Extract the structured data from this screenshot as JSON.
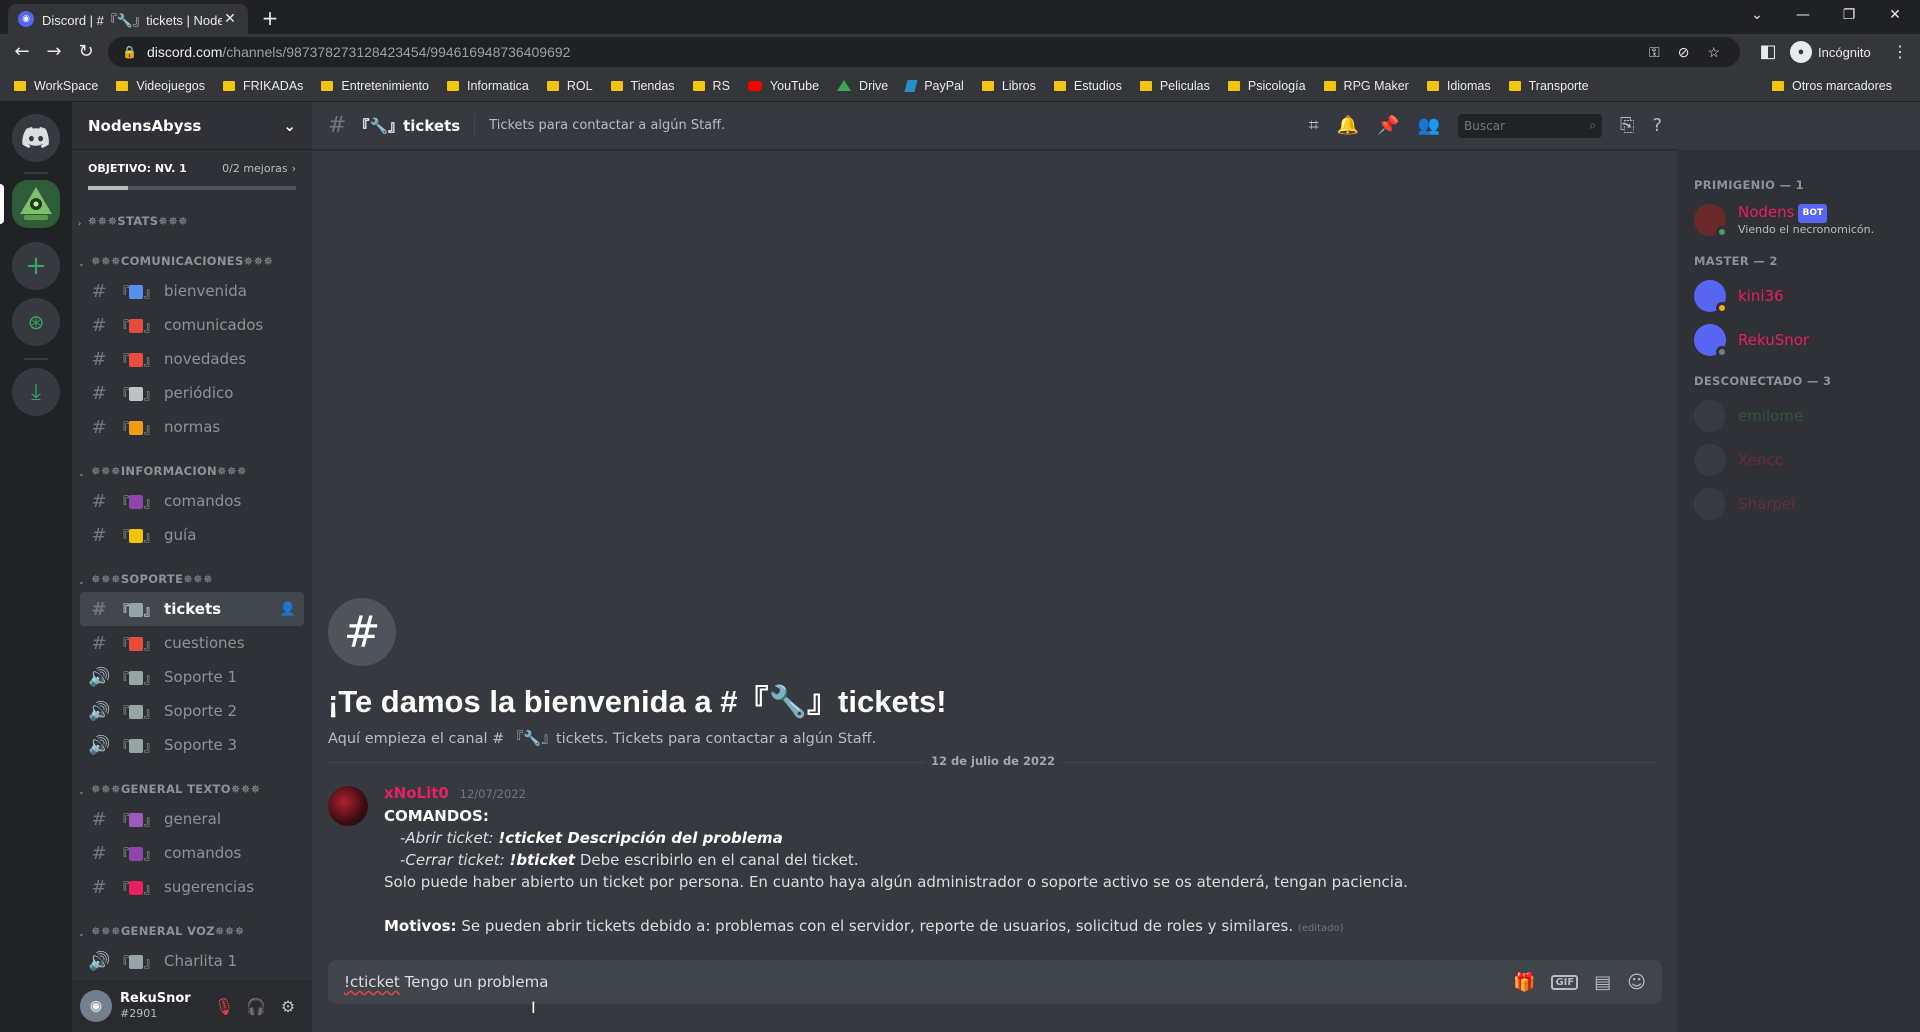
{
  "browser": {
    "tab_title": "Discord | #『🔧』tickets | NodensAbyss",
    "tab_close": "✕",
    "new_tab": "+",
    "url_host": "discord.com",
    "url_path": "/channels/987378273128423454/994616948736409692",
    "incognito_label": "Incógnito",
    "bookmarks": [
      "WorkSpace",
      "Videojuegos",
      "FRIKADAs",
      "Entretenimiento",
      "Informatica",
      "ROL",
      "Tiendas",
      "RS",
      "YouTube",
      "Drive",
      "PayPal",
      "Libros",
      "Estudios",
      "Peliculas",
      "Psicología",
      "RPG Maker",
      "Idiomas",
      "Transporte"
    ],
    "other_bookmarks": "Otros marcadores"
  },
  "server": {
    "name": "NodensAbyss",
    "boost_goal": "OBJETIVO: NV. 1",
    "boost_progress": "0/2 mejoras",
    "boost_fraction": 0
  },
  "categories": [
    {
      "name": "✵✵✵STATS✵✵✵",
      "channels": []
    },
    {
      "name": "✵✵✵COMUNICACIONES✵✵✵",
      "channels": [
        {
          "type": "text",
          "deco_color": "#5b8def",
          "name": "bienvenida"
        },
        {
          "type": "text",
          "deco_color": "#e74c3c",
          "name": "comunicados"
        },
        {
          "type": "text",
          "deco_color": "#e74c3c",
          "name": "novedades"
        },
        {
          "type": "text",
          "deco_color": "#bdc3c7",
          "name": "periódico"
        },
        {
          "type": "text",
          "deco_color": "#f39c12",
          "name": "normas"
        }
      ]
    },
    {
      "name": "✵✵✵INFORMACION✵✵✵",
      "channels": [
        {
          "type": "text",
          "deco_color": "#8e44ad",
          "name": "comandos"
        },
        {
          "type": "text",
          "deco_color": "#f1c40f",
          "name": "guía"
        }
      ]
    },
    {
      "name": "✵✵✵SOPORTE✵✵✵",
      "channels": [
        {
          "type": "text",
          "deco_color": "#95a5a6",
          "name": "tickets",
          "active": true
        },
        {
          "type": "text",
          "deco_color": "#e74c3c",
          "name": "cuestiones"
        },
        {
          "type": "voice",
          "deco_color": "#95a5a6",
          "name": "Soporte 1"
        },
        {
          "type": "voice",
          "deco_color": "#95a5a6",
          "name": "Soporte 2"
        },
        {
          "type": "voice",
          "deco_color": "#95a5a6",
          "name": "Soporte 3"
        }
      ]
    },
    {
      "name": "✵✵✵GENERAL TEXTO✵✵✵",
      "channels": [
        {
          "type": "text",
          "deco_color": "#9b59b6",
          "name": "general"
        },
        {
          "type": "text",
          "deco_color": "#8e44ad",
          "name": "comandos"
        },
        {
          "type": "text",
          "deco_color": "#e91e63",
          "name": "sugerencias"
        }
      ]
    },
    {
      "name": "✵✵✵GENERAL VOZ✵✵✵",
      "channels": [
        {
          "type": "voice",
          "deco_color": "#95a5a6",
          "name": "Charlita 1"
        }
      ]
    }
  ],
  "user": {
    "name": "RekuSnor",
    "tag": "#2901"
  },
  "channel_header": {
    "name": "『🔧』tickets",
    "topic": "Tickets para contactar a algún Staff.",
    "search_placeholder": "Buscar"
  },
  "welcome": {
    "title": "¡Te damos la bienvenida a #『🔧』tickets!",
    "subtitle": "Aquí empieza el canal # 『🔧』tickets. Tickets para contactar a algún Staff."
  },
  "date_divider": "12 de julio de 2022",
  "message": {
    "author": "xNoLit0",
    "timestamp": "12/07/2022",
    "heading": "COMANDOS:",
    "open_prefix": "-Abrir ticket: ",
    "open_cmd": "!cticket Descripción del problema",
    "close_prefix": "-Cerrar ticket: ",
    "close_cmd": "!bticket",
    "close_suffix": " Debe escribirlo en el canal del ticket.",
    "note": "Solo puede haber abierto un ticket por persona. En cuanto haya algún administrador o soporte activo se os atenderá, tengan paciencia.",
    "reasons_label": "Motivos:",
    "reasons_text": " Se pueden abrir tickets debido a: problemas con el servidor, reporte de usuarios, solicitud de roles y similares.",
    "edited": "(editado)"
  },
  "composer": {
    "cmd": "!cticket",
    "rest": " Tengo un problema"
  },
  "members": {
    "groups": [
      {
        "title": "PRIMIGENIO — 1",
        "items": [
          {
            "name": "Nodens",
            "bot": "BOT",
            "activity": "Viendo el necronomicón.",
            "color": "#e91e63",
            "status": "#3ba55d"
          }
        ]
      },
      {
        "title": "MASTER — 2",
        "items": [
          {
            "name": "kini36",
            "color": "#e91e63",
            "status": "#faa61a"
          },
          {
            "name": "RekuSnor",
            "color": "#e91e63",
            "status": "#747f8d"
          }
        ]
      },
      {
        "title": "DESCONECTADO — 3",
        "items": [
          {
            "name": "emilome",
            "color": "#3ba55d",
            "offline": true
          },
          {
            "name": "Xencc",
            "color": "#e91e63",
            "offline": true
          },
          {
            "name": "Sharpei",
            "color": "#e91e63",
            "offline": true
          }
        ]
      }
    ]
  },
  "colors": {
    "accent": "#5865f2",
    "green": "#3ba55d",
    "mention": "#e91e63"
  }
}
